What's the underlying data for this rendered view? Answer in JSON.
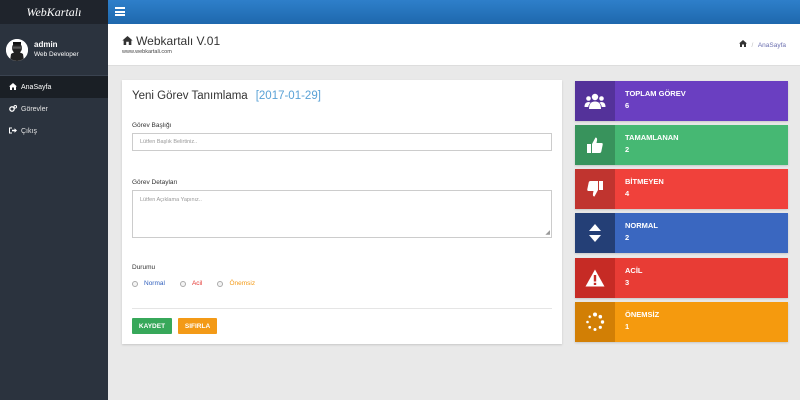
{
  "app": {
    "brand": "WebKartalı"
  },
  "profile": {
    "name": "admin",
    "role": "Web Developer"
  },
  "sidebar": {
    "items": [
      {
        "label": "AnaSayfa",
        "icon": "home-icon"
      },
      {
        "label": "Görevler",
        "icon": "gears-icon"
      },
      {
        "label": "Çıkış",
        "icon": "sign-out-icon"
      }
    ]
  },
  "header": {
    "title": "Webkartalı V.01",
    "subtitle": "www.webkartali.com",
    "breadcrumb": "AnaSayfa"
  },
  "form": {
    "title": "Yeni Görev Tanımlama",
    "date": "[2017-01-29]",
    "title_label": "Görev Başlığı",
    "title_placeholder": "Lütfen Başlık Belirtiniz..",
    "details_label": "Görev Detayları",
    "details_placeholder": "Lütfen Açıklama Yapınız..",
    "status_label": "Durumu",
    "options": [
      {
        "label": "Normal",
        "color": "#2f5fbd"
      },
      {
        "label": "Acil",
        "color": "#e53935"
      },
      {
        "label": "Önemsiz",
        "color": "#f39a17"
      }
    ],
    "save_label": "KAYDET",
    "reset_label": "SIFIRLA"
  },
  "stats": [
    {
      "label": "TOPLAM GÖREV",
      "value": "6",
      "color": "#6a3fc1",
      "icon": "users-icon"
    },
    {
      "label": "TAMAMLANAN",
      "value": "2",
      "color": "#46b873",
      "icon": "thumbs-up-icon"
    },
    {
      "label": "BİTMEYEN",
      "value": "4",
      "color": "#f0413b",
      "icon": "thumbs-down-icon"
    },
    {
      "label": "NORMAL",
      "value": "2",
      "color": "#3a67c0",
      "icon": "sort-icon"
    },
    {
      "label": "ACİL",
      "value": "3",
      "color": "#e83c35",
      "icon": "warning-icon"
    },
    {
      "label": "ÖNEMSİZ",
      "value": "1",
      "color": "#f59a0e",
      "icon": "spinner-icon"
    }
  ]
}
